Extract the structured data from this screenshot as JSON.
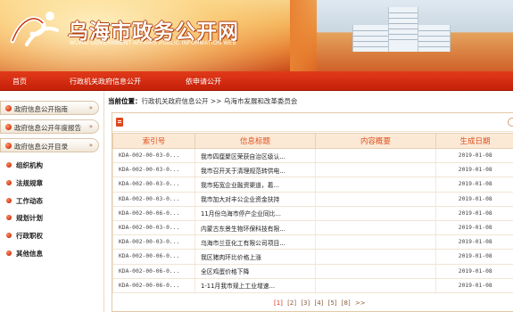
{
  "header": {
    "title": "乌海市政务公开网",
    "subtitle": "WUHAI GOVERNMENT AFFAIRS PUBLIC INFORMATION WEB"
  },
  "nav": {
    "items": [
      "首页",
      "行政机关政府信息公开",
      "依申请公开"
    ]
  },
  "sidebar": {
    "buttons": [
      "政府信息公开指南",
      "政府信息公开年度报告",
      "政府信息公开目录"
    ],
    "arrow": "»",
    "sub_items": [
      "组织机构",
      "法规规章",
      "工作动态",
      "规划计划",
      "行政职权",
      "其他信息"
    ]
  },
  "breadcrumb": {
    "label": "当前位置：",
    "path": "行政机关政府信息公开 >> 乌海市发展和改革委员会"
  },
  "table": {
    "headers": [
      "索引号",
      "信息标题",
      "内容概要",
      "生成日期"
    ],
    "rows": [
      [
        "KDA-002-00-03-0...",
        "我市四厘聚区荣获自治区级认...",
        "",
        "2019-01-08"
      ],
      [
        "KDA-002-00-03-0...",
        "我市召开关于清理规范转供电...",
        "",
        "2019-01-08"
      ],
      [
        "KDA-002-00-03-0...",
        "我市拓宽企业融资渠道，着...",
        "",
        "2019-01-08"
      ],
      [
        "KDA-002-00-03-0...",
        "我市加大对丰公企业资金扶持",
        "",
        "2019-01-08"
      ],
      [
        "KDA-002-00-06-0...",
        "11月份乌海市停产企业同比...",
        "",
        "2019-01-08"
      ],
      [
        "KDA-002-00-03-0...",
        "内蒙古东景生物环保科技有限...",
        "",
        "2019-01-08"
      ],
      [
        "KDA-002-00-03-0...",
        "乌海市兰亚化工有限公司项目...",
        "",
        "2019-01-08"
      ],
      [
        "KDA-002-00-06-0...",
        "我区猪肉环比价格上涨",
        "",
        "2019-01-08"
      ],
      [
        "KDA-002-00-06-0...",
        "全区鸡蛋价格下降",
        "",
        "2019-01-08"
      ],
      [
        "KDA-002-00-06-0...",
        "1-11月我市规上工业增速...",
        "",
        "2019-01-08"
      ]
    ]
  },
  "pager": {
    "pages": [
      "[1]",
      "[2]",
      "[3]",
      "[4]",
      "[5]",
      "[8]",
      ">>"
    ],
    "current": "[1]"
  }
}
